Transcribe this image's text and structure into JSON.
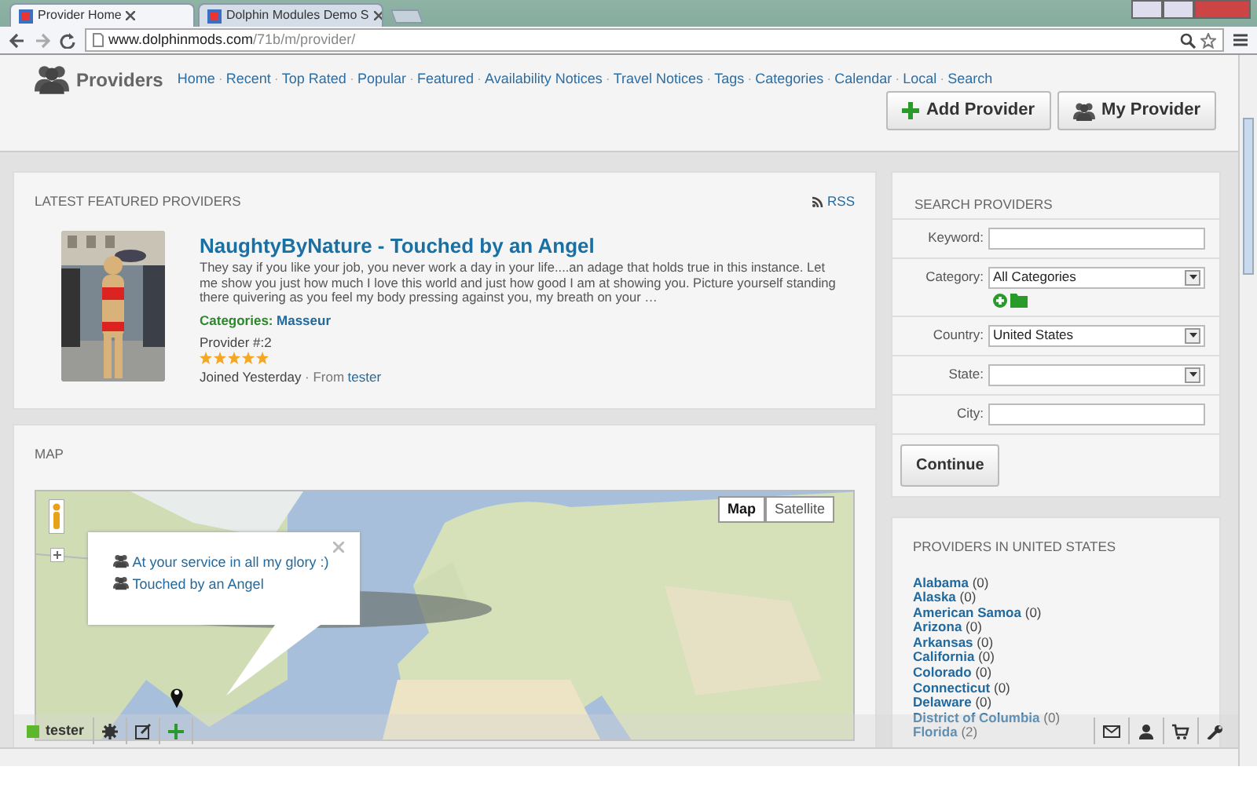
{
  "browser": {
    "tabs": [
      {
        "title": "Provider Home",
        "selected": true
      },
      {
        "title": "Dolphin Modules Demo S",
        "selected": false
      }
    ],
    "url": {
      "host": "www.dolphinmods.com",
      "path": "/71b/m/provider/"
    }
  },
  "header": {
    "title": "Providers",
    "separator": "·",
    "nav": [
      "Home",
      "Recent",
      "Top Rated",
      "Popular",
      "Featured",
      "Availability Notices",
      "Travel Notices",
      "Tags",
      "Categories",
      "Calendar",
      "Local",
      "Search"
    ],
    "buttons": [
      {
        "label": "Add Provider",
        "kind": "add"
      },
      {
        "label": "My Provider",
        "kind": "group"
      }
    ]
  },
  "featured": {
    "heading": "LATEST FEATURED PROVIDERS",
    "rss": "RSS",
    "name": "NaughtyByNature - Touched by an Angel",
    "description": "They say if you like your job, you never work a day in your life....an adage that holds true in this instance. Let me show you just how much I love this world and just how good I am at showing you. Picture yourself standing there quivering as you feel my body pressing against you, my breath on your …",
    "categories_label": "Categories:",
    "category": "Masseur",
    "number": "Provider #:2",
    "stars": 5,
    "joined": "Joined Yesterday",
    "from_label": "· From",
    "from_user": "tester"
  },
  "map": {
    "heading": "MAP",
    "types": [
      {
        "label": "Map",
        "selected": true
      },
      {
        "label": "Satellite",
        "selected": false
      }
    ],
    "popup": [
      "At your service in all my glory :)",
      "Touched by an Angel"
    ]
  },
  "search": {
    "heading": "SEARCH PROVIDERS",
    "fields": [
      {
        "label": "Keyword:",
        "kind": "text"
      },
      {
        "label": "Category:",
        "kind": "select",
        "value": "All Categories",
        "tools": true
      },
      {
        "label": "Country:",
        "kind": "select",
        "value": "United States"
      },
      {
        "label": "State:",
        "kind": "select"
      },
      {
        "label": "City:",
        "kind": "text"
      }
    ],
    "button": "Continue"
  },
  "states": {
    "heading": "PROVIDERS IN UNITED STATES",
    "items": [
      {
        "name": "Alabama",
        "count": "(0)"
      },
      {
        "name": "Alaska",
        "count": "(0)"
      },
      {
        "name": "American Samoa",
        "count": "(0)"
      },
      {
        "name": "Arizona",
        "count": "(0)"
      },
      {
        "name": "Arkansas",
        "count": "(0)"
      },
      {
        "name": "California",
        "count": "(0)"
      },
      {
        "name": "Colorado",
        "count": "(0)"
      },
      {
        "name": "Connecticut",
        "count": "(0)"
      },
      {
        "name": "Delaware",
        "count": "(0)"
      },
      {
        "name": "District of Columbia",
        "count": "(0)"
      },
      {
        "name": "Florida",
        "count": "(2)"
      }
    ]
  },
  "toolbar": {
    "user": "tester",
    "online": true
  }
}
